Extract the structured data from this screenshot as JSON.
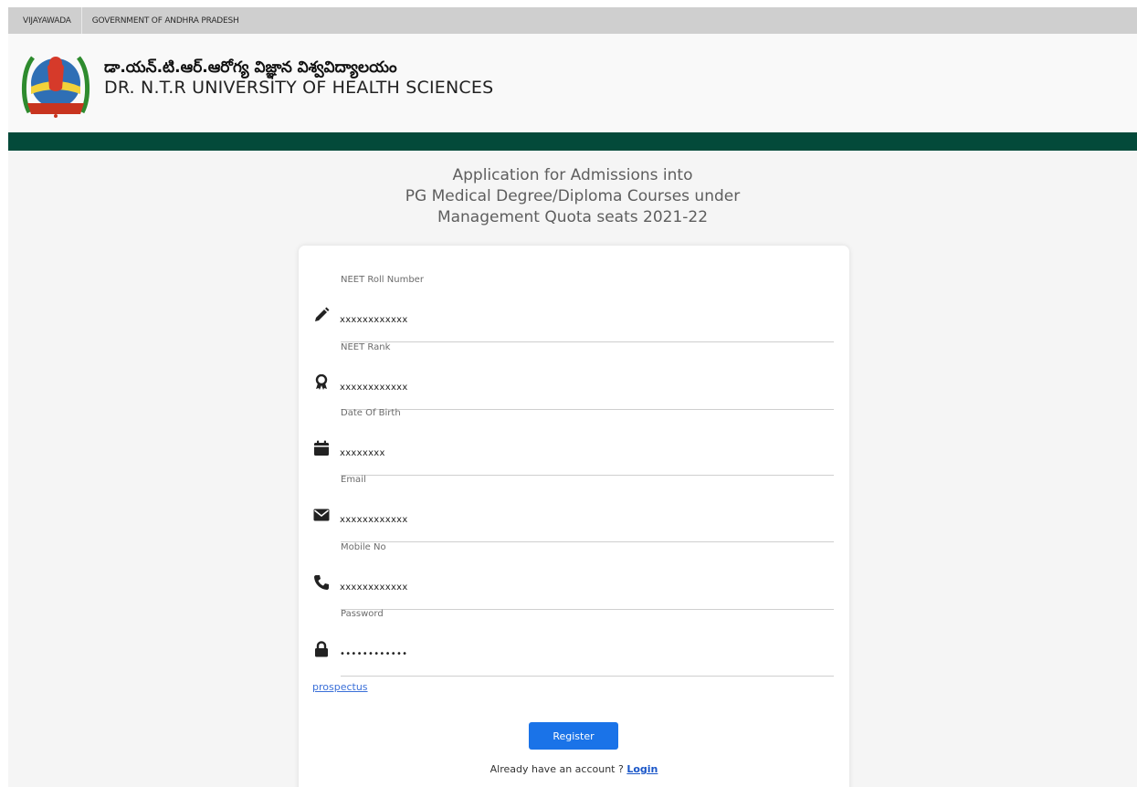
{
  "topbar": {
    "items": [
      "VIJAYAWADA",
      "GOVERNMENT OF ANDHRA PRADESH"
    ]
  },
  "header": {
    "title_telugu": "డా.యన్.టి.ఆర్.ఆరోగ్య విజ్ఞాన విశ్వవిద్యాలయం",
    "title_english": "DR. N.T.R UNIVERSITY OF HEALTH SCIENCES"
  },
  "colors": {
    "band": "#034a3a",
    "button": "#1a73e8",
    "link": "#3a6fd8"
  },
  "page_heading": [
    "Application for Admissions into",
    "PG Medical Degree/Diploma Courses under",
    "Management Quota seats 2021-22"
  ],
  "form": {
    "fields": [
      {
        "label": "NEET Roll Number",
        "value": "xxxxxxxxxxxx",
        "icon": "pencil-icon"
      },
      {
        "label": "NEET Rank",
        "value": "xxxxxxxxxxxx",
        "icon": "award-icon"
      },
      {
        "label": "Date Of Birth",
        "value": "xxxxxxxx",
        "icon": "calendar-icon"
      },
      {
        "label": "Email",
        "value": "xxxxxxxxxxxx",
        "icon": "envelope-icon"
      },
      {
        "label": "Mobile No",
        "value": "xxxxxxxxxxxx",
        "icon": "phone-icon"
      },
      {
        "label": "Password",
        "value": "••••••••••••",
        "icon": "lock-icon"
      }
    ],
    "prospectus_link": "prospectus",
    "register_label": "Register",
    "account_prompt": "Already have an account ?",
    "login_link": "Login"
  }
}
